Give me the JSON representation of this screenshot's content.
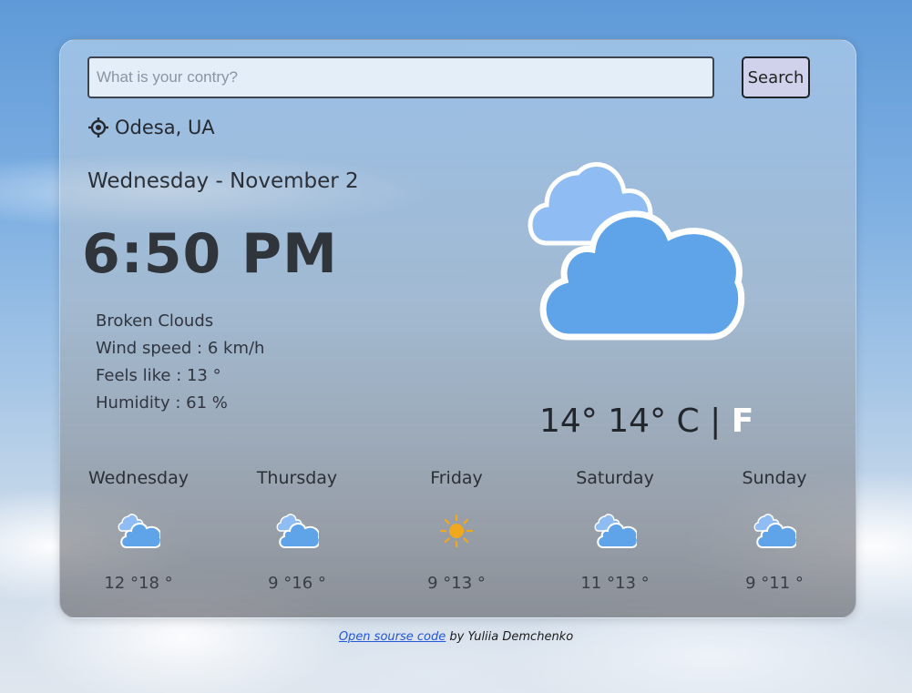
{
  "search": {
    "placeholder": "What is your contry?",
    "value": "",
    "button_label": "Search"
  },
  "location": {
    "icon": "location-target-icon",
    "label": "Odesa, UA"
  },
  "date_label": "Wednesday - November 2",
  "time_label": "6:50 PM",
  "details": {
    "description": "Broken Clouds",
    "wind": "Wind speed : 6 km/h",
    "feels_like": "Feels like : 13 °",
    "humidity": "Humidity : 61 %"
  },
  "current": {
    "icon": "broken-clouds-icon",
    "temp_value": "14°",
    "temp_unit_display": "14°",
    "unit_c": "C",
    "unit_separator": "|",
    "unit_f": "F"
  },
  "forecast": [
    {
      "day": "Wednesday",
      "icon": "broken-clouds-icon",
      "temps": "12 °18 °"
    },
    {
      "day": "Thursday",
      "icon": "broken-clouds-icon",
      "temps": "9 °16 °"
    },
    {
      "day": "Friday",
      "icon": "sun-icon",
      "temps": "9 °13 °"
    },
    {
      "day": "Saturday",
      "icon": "broken-clouds-icon",
      "temps": "11 °13 °"
    },
    {
      "day": "Sunday",
      "icon": "broken-clouds-icon",
      "temps": "9 °11 °"
    }
  ],
  "footer": {
    "link_text": "Open sourse code",
    "suffix": " by Yuliia Demchenko"
  },
  "colors": {
    "cloud_back": "#8fbcf2",
    "cloud_front": "#5fa3e9",
    "sun": "#f2a81c"
  }
}
